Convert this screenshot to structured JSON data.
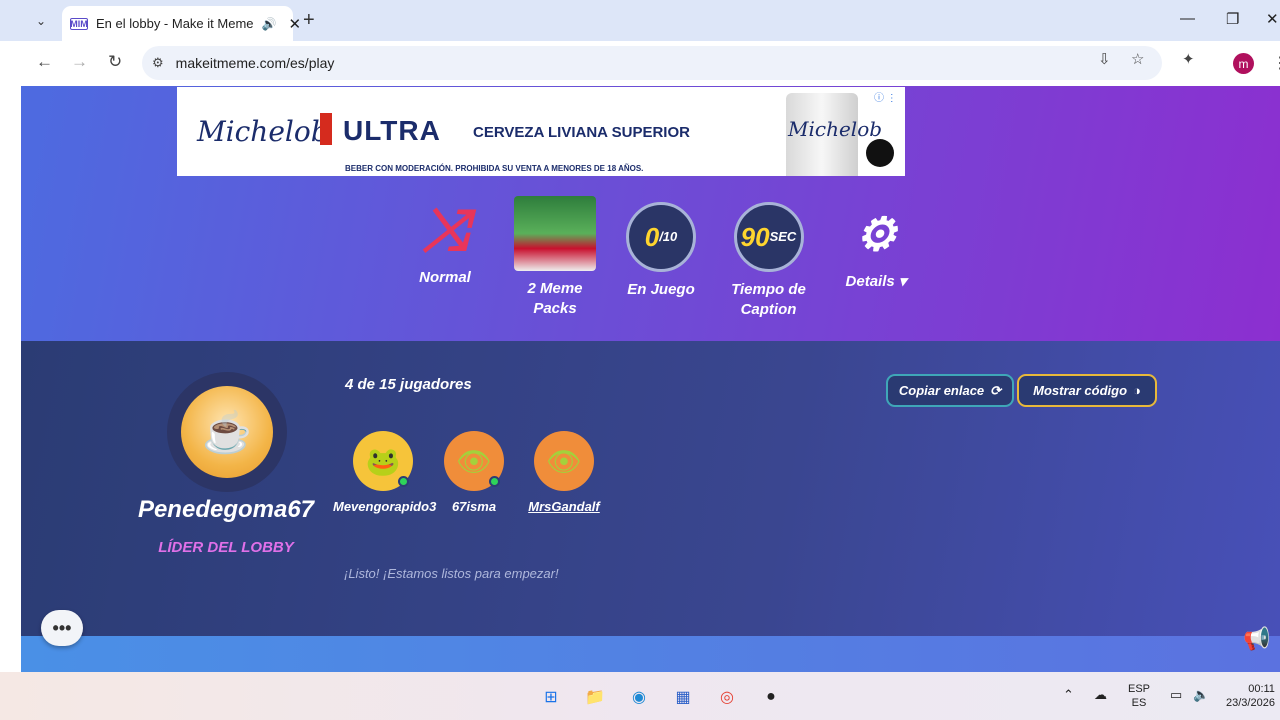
{
  "browser": {
    "tab_title": "En el lobby - Make it Meme",
    "tab_favicon": "MIM",
    "url": "makeitmeme.com/es/play",
    "profile_initial": "m"
  },
  "ad": {
    "brand": "Michelob",
    "product": "ULTRA",
    "tagline": "CERVEZA LIVIANA SUPERIOR",
    "disclaimer": "BEBER CON MODERACIÓN. PROHIBIDA SU VENTA A MENORES DE 18 AÑOS.",
    "can_text": "Michelob"
  },
  "settings": {
    "mode_label": "Normal",
    "packs_label": "2 Meme Packs",
    "rounds_value": "0",
    "rounds_total": "/10",
    "rounds_label": "En Juego",
    "caption_value": "90",
    "caption_unit": "SEC",
    "caption_label_1": "Tiempo de",
    "caption_label_2": "Caption",
    "details_label": "Details"
  },
  "lobby": {
    "leader_name": "Penedegoma67",
    "leader_role": "LÍDER DEL LOBBY",
    "player_count": "4 de  15 jugadores",
    "copy_link_label": "Copiar enlace",
    "show_code_label": "Mostrar código",
    "players": [
      {
        "name": "Mevengorapido3"
      },
      {
        "name": "67isma"
      },
      {
        "name": "MrsGandalf"
      }
    ],
    "ready_text": "¡Listo! ¡Estamos listos para empezar!"
  },
  "taskbar": {
    "lang_1": "ESP",
    "lang_2": "ES",
    "time": "00:11",
    "date": "23/3/2026"
  },
  "colors": {
    "hero_start": "#4d6be0",
    "hero_end": "#8c2fd0",
    "lobby_bg": "#2b3c74",
    "leader_role": "#e070e8",
    "copy_border": "#3fa7b8",
    "code_border": "#e8b93a"
  }
}
